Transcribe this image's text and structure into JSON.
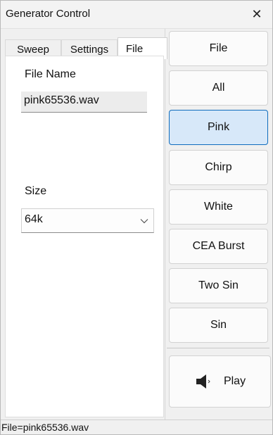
{
  "window": {
    "title": "Generator Control",
    "close_glyph": "✕"
  },
  "tabs": [
    {
      "label": "Sweep",
      "selected": false
    },
    {
      "label": "Settings",
      "selected": false
    },
    {
      "label": "File",
      "selected": true
    }
  ],
  "file_tab": {
    "file_name_label": "File Name",
    "file_name_value": "pink65536.wav",
    "size_label": "Size",
    "size_selected": "64k"
  },
  "buttons": [
    {
      "label": "File",
      "active": false
    },
    {
      "label": "All",
      "active": false
    },
    {
      "label": "Pink",
      "active": true
    },
    {
      "label": "Chirp",
      "active": false
    },
    {
      "label": "White",
      "active": false
    },
    {
      "label": "CEA Burst",
      "active": false
    },
    {
      "label": "Two Sin",
      "active": false
    },
    {
      "label": "Sin",
      "active": false
    }
  ],
  "play_button": {
    "label": "Play",
    "icon": "speaker-icon"
  },
  "status": {
    "text": "File=pink65536.wav"
  },
  "colors": {
    "accent": "#0f6cbd",
    "active_fill": "#d7e8f9"
  }
}
